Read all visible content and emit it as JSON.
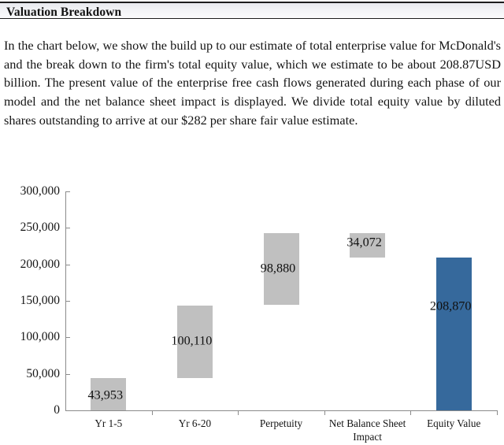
{
  "section": {
    "title": "Valuation Breakdown",
    "body": "In the chart below, we show the build up to our estimate of total enterprise value for McDonald's and the break down to the firm's total equity value, which we estimate to be about 208.87USD billion. The present value of the enterprise free cash flows generated during each phase of our model and the net balance sheet impact is displayed. We divide total equity value by diluted shares outstanding to arrive at our $282 per share fair value estimate."
  },
  "colors": {
    "bar_gray": "#c0c0c0",
    "bar_blue": "#36699c",
    "axis": "#8b8b8b",
    "header_rule": "#1c1c1c"
  },
  "chart_data": {
    "type": "bar",
    "subtype": "waterfall",
    "title": "",
    "xlabel": "",
    "ylabel": "",
    "ylim": [
      0,
      300000
    ],
    "grid": false,
    "legend": null,
    "ytick_labels": [
      "300,000",
      "250,000",
      "200,000",
      "150,000",
      "100,000",
      "50,000",
      "0"
    ],
    "ytick_values": [
      300000,
      250000,
      200000,
      150000,
      100000,
      50000,
      0
    ],
    "categories": [
      "Yr 1-5",
      "Yr 6-20",
      "Perpetuity",
      "Net Balance Sheet Impact",
      "Equity Value"
    ],
    "values": [
      43953,
      100110,
      98880,
      34072,
      208870
    ],
    "value_labels": [
      "43,953",
      "100,110",
      "98,880",
      "34,072",
      "208,870"
    ],
    "bars": [
      {
        "label": "Yr 1-5",
        "value_label": "43,953",
        "value": 43953,
        "base": 0,
        "top": 43953,
        "color": "#c0c0c0",
        "kind": "increase"
      },
      {
        "label": "Yr 6-20",
        "value_label": "100,110",
        "value": 100110,
        "base": 43953,
        "top": 144063,
        "color": "#c0c0c0",
        "kind": "increase"
      },
      {
        "label": "Perpetuity",
        "value_label": "98,880",
        "value": 98880,
        "base": 144063,
        "top": 242943,
        "color": "#c0c0c0",
        "kind": "increase"
      },
      {
        "label": "Net Balance Sheet Impact",
        "value_label": "34,072",
        "value": -34072,
        "base": 208871,
        "top": 242943,
        "color": "#c0c0c0",
        "kind": "decrease"
      },
      {
        "label": "Equity Value",
        "value_label": "208,870",
        "value": 208870,
        "base": 0,
        "top": 208870,
        "color": "#36699c",
        "kind": "total"
      }
    ]
  }
}
